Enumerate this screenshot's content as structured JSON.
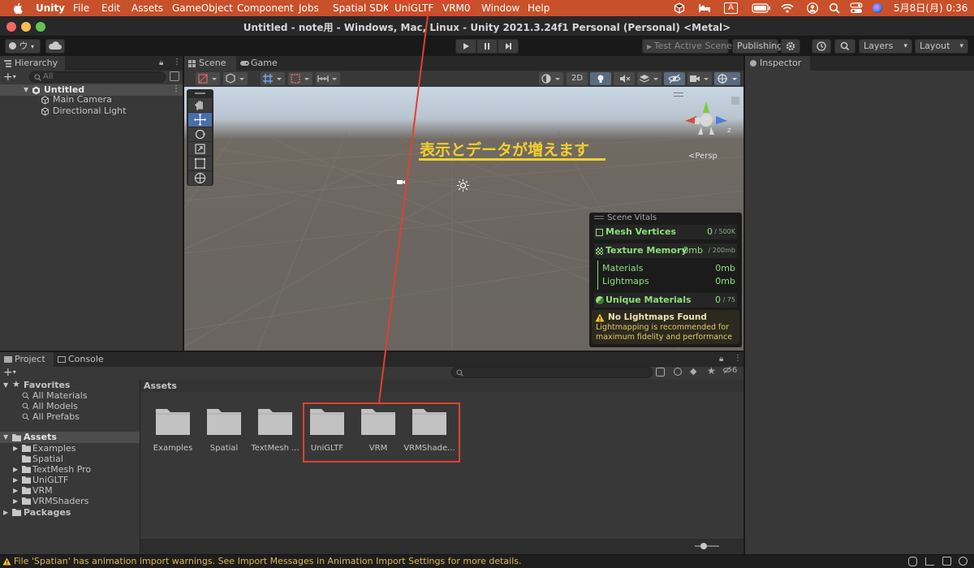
{
  "menubar": {
    "app": "Unity",
    "items": [
      "File",
      "Edit",
      "Assets",
      "GameObject",
      "Component",
      "Jobs",
      "Spatial SDK",
      "UniGLTF",
      "VRM0",
      "Window",
      "Help"
    ],
    "date": "5月8日(月) 0:36",
    "input_icon": "A",
    "icons": [
      "apple-icon",
      "package-icon",
      "bed-icon",
      "keyboard-icon",
      "battery-icon",
      "wifi-icon",
      "user-icon",
      "search-icon",
      "control-center-icon",
      "siri-icon"
    ]
  },
  "window": {
    "title": "Untitled - note用 - Windows, Mac, Linux - Unity 2021.3.24f1 Personal (Personal) <Metal>"
  },
  "toolbar": {
    "account": "ウ",
    "test_active_scene": "Test Active Scene",
    "publishing": "Publishing",
    "layers": "Layers",
    "layout": "Layout"
  },
  "hierarchy": {
    "tab": "Hierarchy",
    "search_placeholder": "All",
    "scene": "Untitled",
    "items": [
      "Main Camera",
      "Directional Light"
    ]
  },
  "scene": {
    "tabs": [
      "Scene",
      "Game"
    ],
    "mode_2d": "2D",
    "persp": "<Persp",
    "axis_z": "z",
    "annotation": "表示とデータが増えます"
  },
  "vitals": {
    "title": "Scene Vitals",
    "mesh_label": "Mesh Vertices",
    "mesh_value": "0",
    "mesh_limit": "/ 500K",
    "tex_label": "Texture Memory",
    "tex_value": "0mb",
    "tex_limit": "/ 200mb",
    "materials_label": "Materials",
    "materials_value": "0mb",
    "lightmaps_label": "Lightmaps",
    "lightmaps_value": "0mb",
    "unique_label": "Unique Materials",
    "unique_value": "0",
    "unique_limit": "/ 75",
    "warning_title": "No Lightmaps Found",
    "warning_text": "Lightmapping is recommended for maximum fidelity and performance"
  },
  "inspector": {
    "tab": "Inspector"
  },
  "project": {
    "tabs": [
      "Project",
      "Console"
    ],
    "hidden_count": "6",
    "favorites": {
      "label": "Favorites",
      "items": [
        "All Materials",
        "All Models",
        "All Prefabs"
      ]
    },
    "assets_root": "Assets",
    "asset_tree": [
      "Examples",
      "Spatial",
      "TextMesh Pro",
      "UniGLTF",
      "VRM",
      "VRMShaders"
    ],
    "packages": "Packages",
    "breadcrumb": "Assets",
    "folders": [
      "Examples",
      "Spatial",
      "TextMesh ...",
      "UniGLTF",
      "VRM",
      "VRMShade..."
    ]
  },
  "status": {
    "message": "File 'Spatian' has animation import warnings. See Import Messages in Animation Import Settings for more details."
  },
  "colors": {
    "menubar": "#c8502a",
    "accent": "#e0412f",
    "annotation": "#f2d02b",
    "vitals_green": "#8fe07a"
  }
}
